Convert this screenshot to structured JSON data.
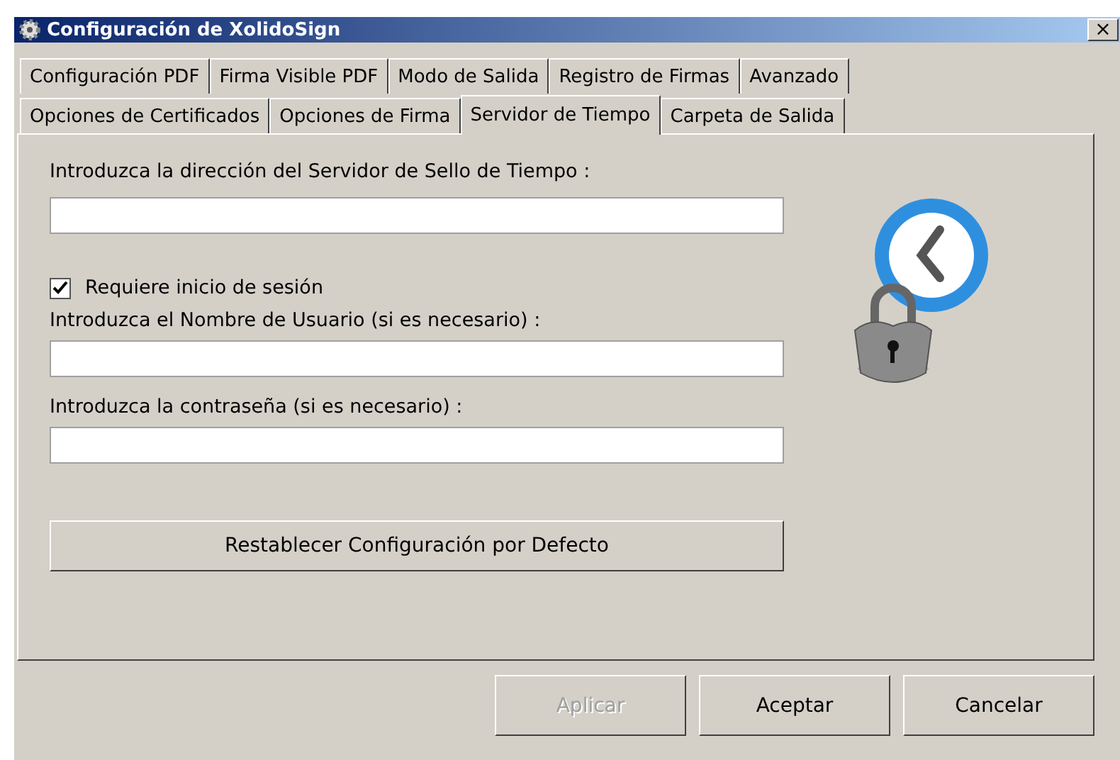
{
  "window": {
    "title": "Configuración de XolidoSign",
    "close": "×"
  },
  "tab_rows": [
    [
      {
        "label": "Configuración PDF",
        "selected": false
      },
      {
        "label": "Firma Visible PDF",
        "selected": false
      },
      {
        "label": "Modo de Salida",
        "selected": false
      },
      {
        "label": "Registro de Firmas",
        "selected": false
      },
      {
        "label": "Avanzado",
        "selected": false
      }
    ],
    [
      {
        "label": "Opciones de Certificados",
        "selected": false
      },
      {
        "label": "Opciones de Firma",
        "selected": false
      },
      {
        "label": "Servidor de Tiempo",
        "selected": true
      },
      {
        "label": "Carpeta de Salida",
        "selected": false
      }
    ]
  ],
  "server": {
    "label": "Introduzca la dirección del Servidor de Sello de Tiempo :"
  },
  "login": {
    "label": "Requiere inicio de sesión",
    "checked": true
  },
  "username": {
    "label": "Introduzca el Nombre de Usuario (si es necesario) :"
  },
  "password": {
    "label": "Introduzca la contraseña (si es necesario) :"
  },
  "reset_button": "Restablecer Configuración por Defecto",
  "buttons": [
    {
      "label": "Aplicar",
      "disabled": true
    },
    {
      "label": "Aceptar",
      "disabled": false
    },
    {
      "label": "Cancelar",
      "disabled": false
    }
  ]
}
